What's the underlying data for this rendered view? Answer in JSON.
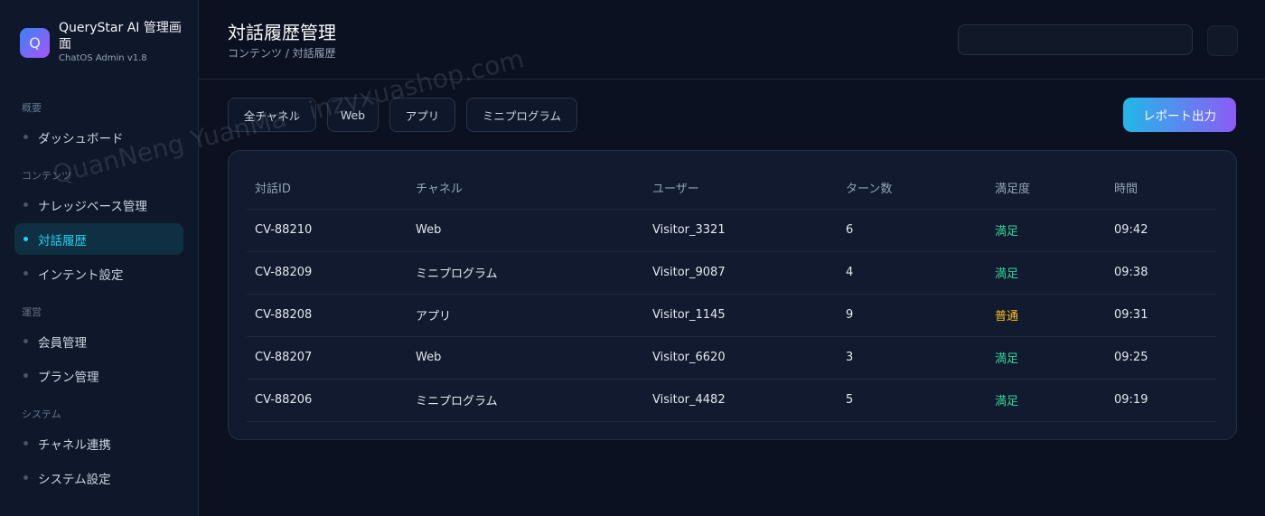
{
  "brand": {
    "logo_letter": "Q",
    "title": "QueryStar AI 管理画面",
    "subtitle": "ChatOS Admin v1.8"
  },
  "sidebar": {
    "sections": [
      {
        "label": "概要",
        "items": [
          {
            "label": "ダッシュボード",
            "active": false
          }
        ]
      },
      {
        "label": "コンテンツ",
        "items": [
          {
            "label": "ナレッジベース管理",
            "active": false
          },
          {
            "label": "対話履歴",
            "active": true
          },
          {
            "label": "インテント設定",
            "active": false
          }
        ]
      },
      {
        "label": "運営",
        "items": [
          {
            "label": "会員管理",
            "active": false
          },
          {
            "label": "プラン管理",
            "active": false
          }
        ]
      },
      {
        "label": "システム",
        "items": [
          {
            "label": "チャネル連携",
            "active": false
          },
          {
            "label": "システム設定",
            "active": false
          }
        ]
      }
    ]
  },
  "header": {
    "title": "対話履歴管理",
    "breadcrumb": "コンテンツ / 対話履歴",
    "search_placeholder": ""
  },
  "filters": [
    "全チャネル",
    "Web",
    "アプリ",
    "ミニプログラム"
  ],
  "export_label": "レポート出力",
  "table": {
    "columns": [
      "対話ID",
      "チャネル",
      "ユーザー",
      "ターン数",
      "満足度",
      "時間"
    ],
    "rows": [
      [
        "CV-88210",
        "Web",
        "Visitor_3321",
        "6",
        "満足",
        "09:42"
      ],
      [
        "CV-88209",
        "ミニプログラム",
        "Visitor_9087",
        "4",
        "満足",
        "09:38"
      ],
      [
        "CV-88208",
        "アプリ",
        "Visitor_1145",
        "9",
        "普通",
        "09:31"
      ],
      [
        "CV-88207",
        "Web",
        "Visitor_6620",
        "3",
        "満足",
        "09:25"
      ],
      [
        "CV-88206",
        "ミニプログラム",
        "Visitor_4482",
        "5",
        "満足",
        "09:19"
      ]
    ]
  },
  "watermark": "QuanNeng YuanMa · inzyxuashop.com",
  "colors": {
    "accent": "#22d3ee",
    "satisfied": "#34d399",
    "normal": "#fbbf24",
    "background": "#0b1120"
  }
}
